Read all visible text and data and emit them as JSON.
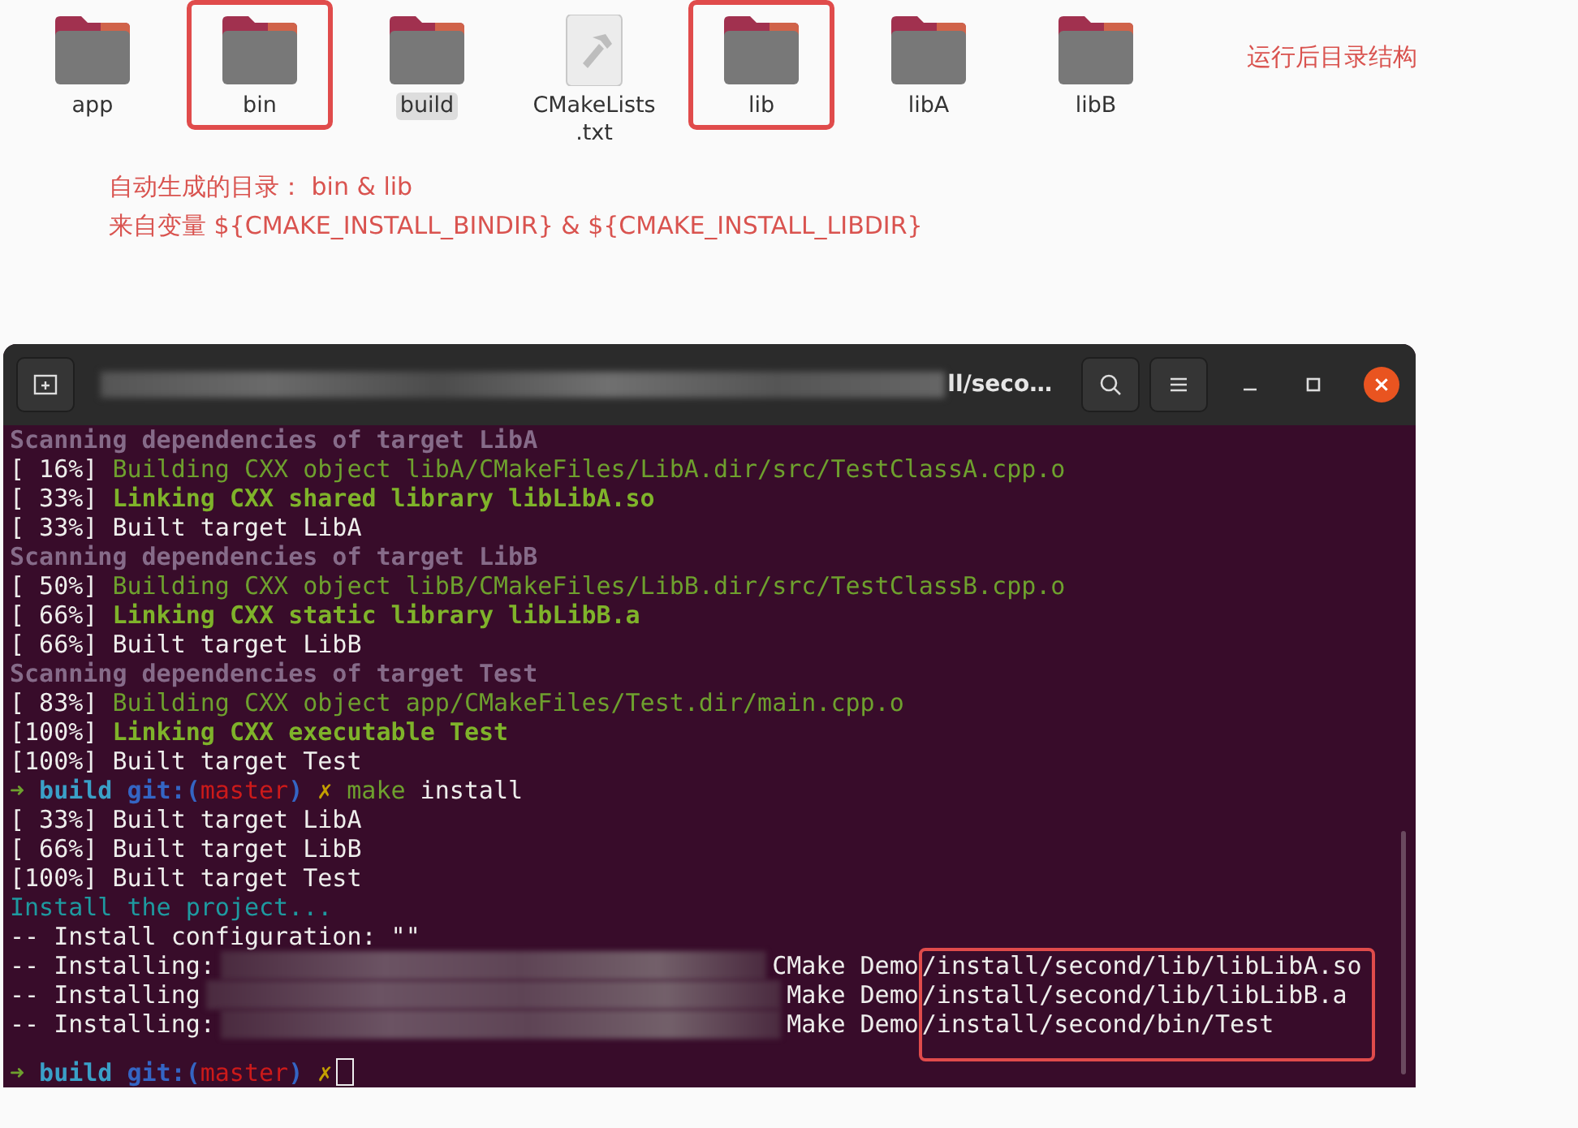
{
  "folder_view": {
    "items": [
      {
        "name": "app",
        "kind": "folder",
        "highlighted": false,
        "selected": false
      },
      {
        "name": "bin",
        "kind": "folder",
        "highlighted": true,
        "selected": false
      },
      {
        "name": "build",
        "kind": "folder",
        "highlighted": false,
        "selected": true
      },
      {
        "name": "CMakeLists.txt",
        "kind": "file",
        "highlighted": false,
        "selected": false
      },
      {
        "name": "lib",
        "kind": "folder",
        "highlighted": true,
        "selected": false
      },
      {
        "name": "libA",
        "kind": "folder",
        "highlighted": false,
        "selected": false
      },
      {
        "name": "libB",
        "kind": "folder",
        "highlighted": false,
        "selected": false
      }
    ],
    "annotation": "运行后目录结构",
    "notes": [
      "自动生成的目录： bin & lib",
      "来自变量 ${CMAKE_INSTALL_BINDIR} & ${CMAKE_INSTALL_LIBDIR}"
    ]
  },
  "terminal": {
    "title": "ll/seco…",
    "lines": [
      {
        "kind": "scan",
        "text": "Scanning dependencies of target LibA"
      },
      {
        "kind": "build",
        "prefix": "[ 16%]",
        "text": "Building CXX object libA/CMakeFiles/LibA.dir/src/TestClassA.cpp.o"
      },
      {
        "kind": "link",
        "prefix": "[ 33%]",
        "text": "Linking CXX shared library libLibA.so"
      },
      {
        "kind": "plain",
        "text": "[ 33%] Built target LibA"
      },
      {
        "kind": "scan",
        "text": "Scanning dependencies of target LibB"
      },
      {
        "kind": "build",
        "prefix": "[ 50%]",
        "text": "Building CXX object libB/CMakeFiles/LibB.dir/src/TestClassB.cpp.o"
      },
      {
        "kind": "link",
        "prefix": "[ 66%]",
        "text": "Linking CXX static library libLibB.a"
      },
      {
        "kind": "plain",
        "text": "[ 66%] Built target LibB"
      },
      {
        "kind": "scan",
        "text": "Scanning dependencies of target Test"
      },
      {
        "kind": "build",
        "prefix": "[ 83%]",
        "text": "Building CXX object app/CMakeFiles/Test.dir/main.cpp.o"
      },
      {
        "kind": "link",
        "prefix": "[100%]",
        "text": "Linking CXX executable Test"
      },
      {
        "kind": "plain",
        "text": "[100%] Built target Test"
      },
      {
        "kind": "prompt",
        "arrow": "➜",
        "dir": "build",
        "git": "git:(",
        "branch": "master",
        "close": ")",
        "dirty": "✗",
        "command": "make",
        "args": "install",
        "cursor": false
      },
      {
        "kind": "plain",
        "text": "[ 33%] Built target LibA"
      },
      {
        "kind": "plain",
        "text": "[ 66%] Built target LibB"
      },
      {
        "kind": "plain",
        "text": "[100%] Built target Test"
      },
      {
        "kind": "info",
        "text": "Install the project..."
      },
      {
        "kind": "plain",
        "text": "-- Install configuration: \"\""
      },
      {
        "kind": "install_group",
        "highlighted": true,
        "lines": [
          {
            "prefix": "-- Installing:",
            "lead": "CMake Demo",
            "path": "/install/second/lib/libLibA.so"
          },
          {
            "prefix": "-- Installing",
            "lead": "Make Demo",
            "path": "/install/second/lib/libLibB.a"
          },
          {
            "prefix": "-- Installing:",
            "lead": "Make Demo",
            "path": "/install/second/bin/Test"
          }
        ]
      },
      {
        "kind": "prompt",
        "arrow": "➜",
        "dir": "build",
        "git": "git:(",
        "branch": "master",
        "close": ")",
        "dirty": "✗",
        "cursor": true
      }
    ]
  }
}
